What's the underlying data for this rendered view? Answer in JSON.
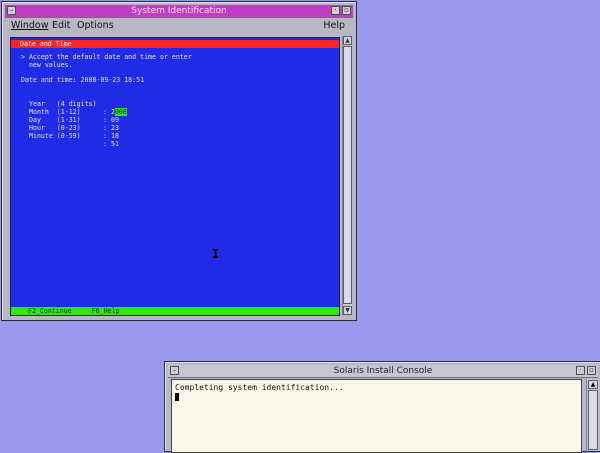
{
  "sysid_window": {
    "title": "System Identification",
    "menu": {
      "window": "Window",
      "edit": "Edit",
      "options": "Options",
      "help": "Help"
    },
    "screen": {
      "header": "Date and Time",
      "instruction_1": "> Accept the default date and time or enter",
      "instruction_2": "  new values.",
      "datetime_label": "Date and time: 2008-09-23 18:51",
      "fields": [
        {
          "label": "Year   (4 digits)",
          "sep": ":",
          "value_prefix": "2",
          "value_rest": "008"
        },
        {
          "label": "Month  (1-12)",
          "sep": ":",
          "value": "09"
        },
        {
          "label": "Day    (1-31)",
          "sep": ":",
          "value": "23"
        },
        {
          "label": "Hour   (0-23)",
          "sep": ":",
          "value": "18"
        },
        {
          "label": "Minute (0-59)",
          "sep": ":",
          "value": "51"
        }
      ],
      "footer_keys": [
        "F2_Continue",
        "F6_Help"
      ]
    }
  },
  "console_window": {
    "title": "Solaris Install Console",
    "output_line": "Completing system identification..."
  },
  "colors": {
    "desktop": "#9999ee",
    "sysid_titlebar": "#c03ec4",
    "term_bg": "#1f2be6",
    "term_header": "#ff2424",
    "term_footer": "#2ee80a",
    "console_bg": "#fbf8e9"
  },
  "icons": {
    "window_menu": "window-menu-icon",
    "minimize": "minimize-icon",
    "maximize": "maximize-icon",
    "mouse_cursor": "ibeam-cursor-icon"
  }
}
